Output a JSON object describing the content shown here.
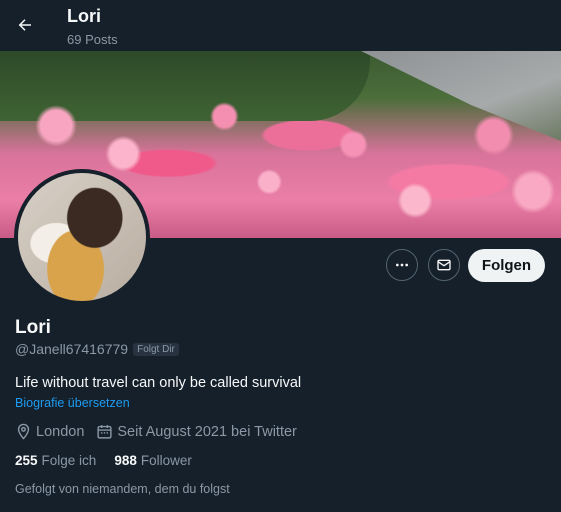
{
  "header": {
    "title": "Lori",
    "posts_count": "69 Posts"
  },
  "profile": {
    "name": "Lori",
    "handle": "@Janell67416779",
    "follows_you_badge": "Folgt Dir",
    "bio": "Life without travel can only be called survival",
    "translate_link": "Biografie übersetzen",
    "location": "London",
    "joined": "Seit August 2021 bei Twitter",
    "following_count": "255",
    "following_label": "Folge ich",
    "followers_count": "988",
    "followers_label": "Follower",
    "followed_by_text": "Gefolgt von niemandem, dem du folgst"
  },
  "actions": {
    "follow_label": "Folgen"
  },
  "icons": {
    "back": "arrow-left-icon",
    "more": "more-dots-icon",
    "message": "envelope-icon",
    "location": "map-pin-icon",
    "calendar": "calendar-icon"
  },
  "colors": {
    "background": "#15202b",
    "text": "#f7f9f9",
    "secondary_text": "#8b98a5",
    "link": "#1d9bf0",
    "follow_button": "#eff3f4"
  }
}
